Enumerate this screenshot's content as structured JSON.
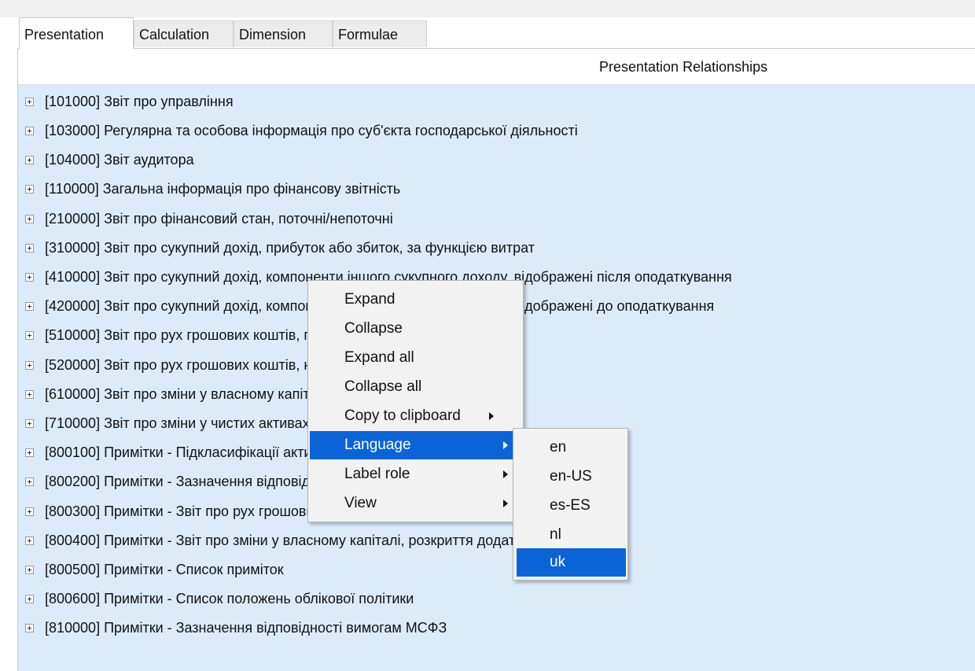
{
  "tabs": [
    {
      "label": "Presentation",
      "active": true
    },
    {
      "label": "Calculation",
      "active": false
    },
    {
      "label": "Dimension",
      "active": false
    },
    {
      "label": "Formulae",
      "active": false
    }
  ],
  "tree": {
    "header": "Presentation Relationships",
    "rows": [
      "[101000] Звіт про управління",
      "[103000] Регулярна та особова інформація про суб'єкта господарської діяльності",
      "[104000] Звіт аудитора",
      "[110000] Загальна інформація про фінансову звітність",
      "[210000] Звіт про фінансовий стан, поточні/непоточні",
      "[310000] Звіт про сукупний дохід, прибуток або збиток, за функцією витрат",
      "[410000] Звіт про сукупний дохід, компоненти іншого сукупного доходу, відображені після оподаткування",
      "[420000] Звіт про сукупний дохід, компоненти іншого сукупного доходу, відображені до оподаткування",
      "[510000] Звіт про рух грошових коштів, прямий метод",
      "[520000] Звіт про рух грошових коштів, непрямий метод",
      "[610000] Звіт про зміни у власному капіталі",
      "[710000] Звіт про зміни у чистих активах",
      "[800100] Примітки - Підкласифікації активів, зобов'язань та власного капіталу",
      "[800200] Примітки - Зазначення відповідності",
      "[800300] Примітки - Звіт про рух грошових коштів, розкриття додаткової інформації",
      "[800400] Примітки - Звіт про зміни у власному капіталі, розкриття додаткової інформації",
      "[800500] Примітки - Список приміток",
      "[800600] Примітки - Список положень облікової політики",
      "[810000] Примітки - Зазначення відповідності вимогам МСФЗ"
    ]
  },
  "context_menu": {
    "items": [
      {
        "label": "Expand",
        "submenu": false
      },
      {
        "label": "Collapse",
        "submenu": false
      },
      {
        "label": "Expand all",
        "submenu": false
      },
      {
        "label": "Collapse all",
        "submenu": false
      },
      {
        "label": "Copy to clipboard",
        "submenu": true
      },
      {
        "label": "Language",
        "submenu": true,
        "highlighted": true
      },
      {
        "label": "Label role",
        "submenu": true
      },
      {
        "label": "View",
        "submenu": true
      }
    ]
  },
  "language_submenu": {
    "items": [
      {
        "label": "en"
      },
      {
        "label": "en-US"
      },
      {
        "label": "es-ES"
      },
      {
        "label": "nl"
      },
      {
        "label": "uk",
        "selected": true
      }
    ]
  },
  "colors": {
    "tree_background": "#dcebfa",
    "highlight": "#0a64d8",
    "menu_background": "#f2f2f2"
  }
}
